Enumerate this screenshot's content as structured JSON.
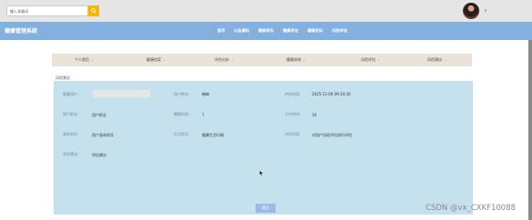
{
  "search": {
    "placeholder": "输入关键词"
  },
  "header": {
    "brand": "健康管理系统",
    "nav": [
      "首页",
      "公告通知",
      "健康资讯",
      "健康评估",
      "健康目标",
      "风险评估"
    ]
  },
  "tabs": [
    "个人首页",
    "健康档案",
    "评估分析",
    "健康咨询",
    "风险评估",
    "风险建议"
  ],
  "breadcrumb": "风险建议",
  "form": {
    "user_account": {
      "label": "健康用户:",
      "value": ""
    },
    "user_name": {
      "label": "用户姓名:",
      "value": "韩梅"
    },
    "eval_time": {
      "label": "评估时间:",
      "value": "2025-11-06 09:34:30"
    },
    "user_occupation": {
      "label": "用户职业:",
      "value": "用户职业"
    },
    "sleep_time": {
      "label": "睡眠时间:",
      "value": "7"
    },
    "work_time": {
      "label": "工作时间:",
      "value": "10"
    },
    "body_status": {
      "label": "身体状况:",
      "value": "用户身体状况"
    },
    "lifestyle": {
      "label": "生活状况:",
      "value": "健康生活行情"
    },
    "eval_content": {
      "label": "评估内容:",
      "value": "对用户风险评估进行评估"
    },
    "eval_advice": {
      "label": "评估建议:",
      "value": "评估建议"
    }
  },
  "submit_label": "提交",
  "watermark": "CSDN @vx_CXKF10088"
}
